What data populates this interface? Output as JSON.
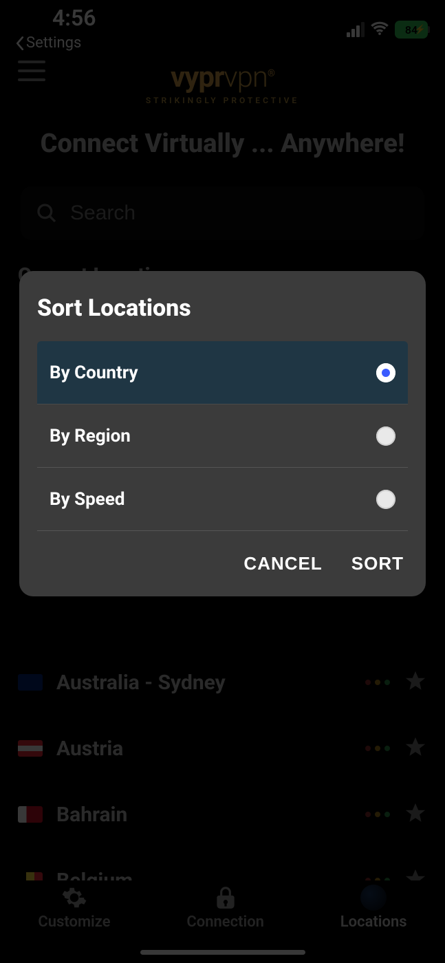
{
  "status": {
    "time": "4:56",
    "back_label": "Settings",
    "battery_pct": "84",
    "battery_charging": true,
    "signal_bars_active": 3,
    "wifi": true
  },
  "brand": {
    "name_strong": "vypr",
    "name_light": "vpn",
    "tagline": "STRIKINGLY PROTECTIVE"
  },
  "hero": {
    "title": "Connect Virtually ... Anywhere!",
    "search_placeholder": "Search"
  },
  "sections": {
    "current": "Current Location"
  },
  "locations": [
    {
      "name": "Australia - Sydney",
      "flag": "au"
    },
    {
      "name": "Austria",
      "flag": "at"
    },
    {
      "name": "Bahrain",
      "flag": "bh"
    },
    {
      "name": "Belgium",
      "flag": "be"
    }
  ],
  "tabs": {
    "customize": "Customize",
    "connection": "Connection",
    "locations": "Locations"
  },
  "modal": {
    "title": "Sort Locations",
    "options": [
      {
        "label": "By Country",
        "selected": true
      },
      {
        "label": "By Region",
        "selected": false
      },
      {
        "label": "By Speed",
        "selected": false
      }
    ],
    "cancel": "CANCEL",
    "confirm": "SORT"
  }
}
